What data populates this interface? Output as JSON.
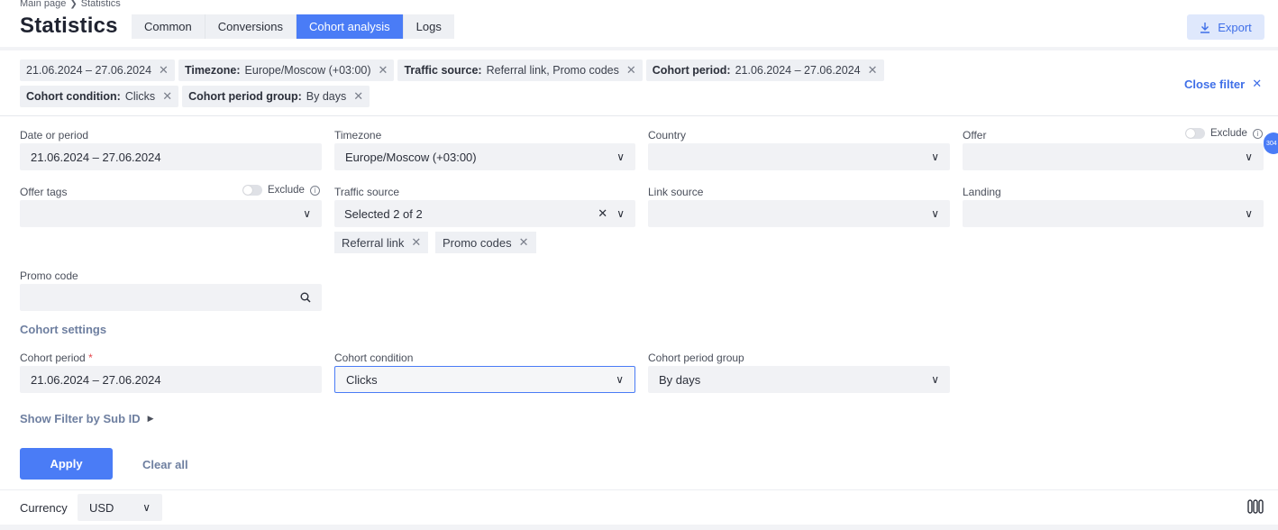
{
  "breadcrumb": {
    "home": "Main page",
    "current": "Statistics"
  },
  "page_title": "Statistics",
  "tabs": [
    {
      "label": "Common"
    },
    {
      "label": "Conversions"
    },
    {
      "label": "Cohort analysis",
      "active": true
    },
    {
      "label": "Logs"
    }
  ],
  "export_label": "Export",
  "chips": {
    "date": {
      "value": "21.06.2024 – 27.06.2024"
    },
    "timezone": {
      "key": "Timezone:",
      "value": "Europe/Moscow (+03:00)"
    },
    "traffic_source": {
      "key": "Traffic source:",
      "value": "Referral link, Promo codes"
    },
    "cohort_period": {
      "key": "Cohort period:",
      "value": "21.06.2024 – 27.06.2024"
    },
    "cohort_condition": {
      "key": "Cohort condition:",
      "value": "Clicks"
    },
    "cohort_period_group": {
      "key": "Cohort period group:",
      "value": "By days"
    }
  },
  "close_filter_label": "Close filter",
  "badge": "304",
  "form": {
    "date_label": "Date or period",
    "date_value": "21.06.2024 – 27.06.2024",
    "timezone_label": "Timezone",
    "timezone_value": "Europe/Moscow (+03:00)",
    "country_label": "Country",
    "offer_label": "Offer",
    "exclude_label": "Exclude",
    "offer_tags_label": "Offer tags",
    "traffic_source_label": "Traffic source",
    "traffic_source_value": "Selected 2 of 2",
    "traffic_source_tags": [
      "Referral link",
      "Promo codes"
    ],
    "link_source_label": "Link source",
    "landing_label": "Landing",
    "promo_code_label": "Promo code",
    "cohort_settings_title": "Cohort settings",
    "cohort_period_label": "Cohort period",
    "cohort_period_value": "21.06.2024 – 27.06.2024",
    "cohort_condition_label": "Cohort condition",
    "cohort_condition_value": "Clicks",
    "cohort_period_group_label": "Cohort period group",
    "cohort_period_group_value": "By days",
    "show_filter_sub_id": "Show Filter by Sub ID",
    "apply_label": "Apply",
    "clear_all_label": "Clear all"
  },
  "currency": {
    "label": "Currency",
    "value": "USD"
  },
  "colors": {
    "accent": "#4a7cf6",
    "muted_link": "#6e7fa0",
    "field_bg": "#f1f2f5"
  }
}
